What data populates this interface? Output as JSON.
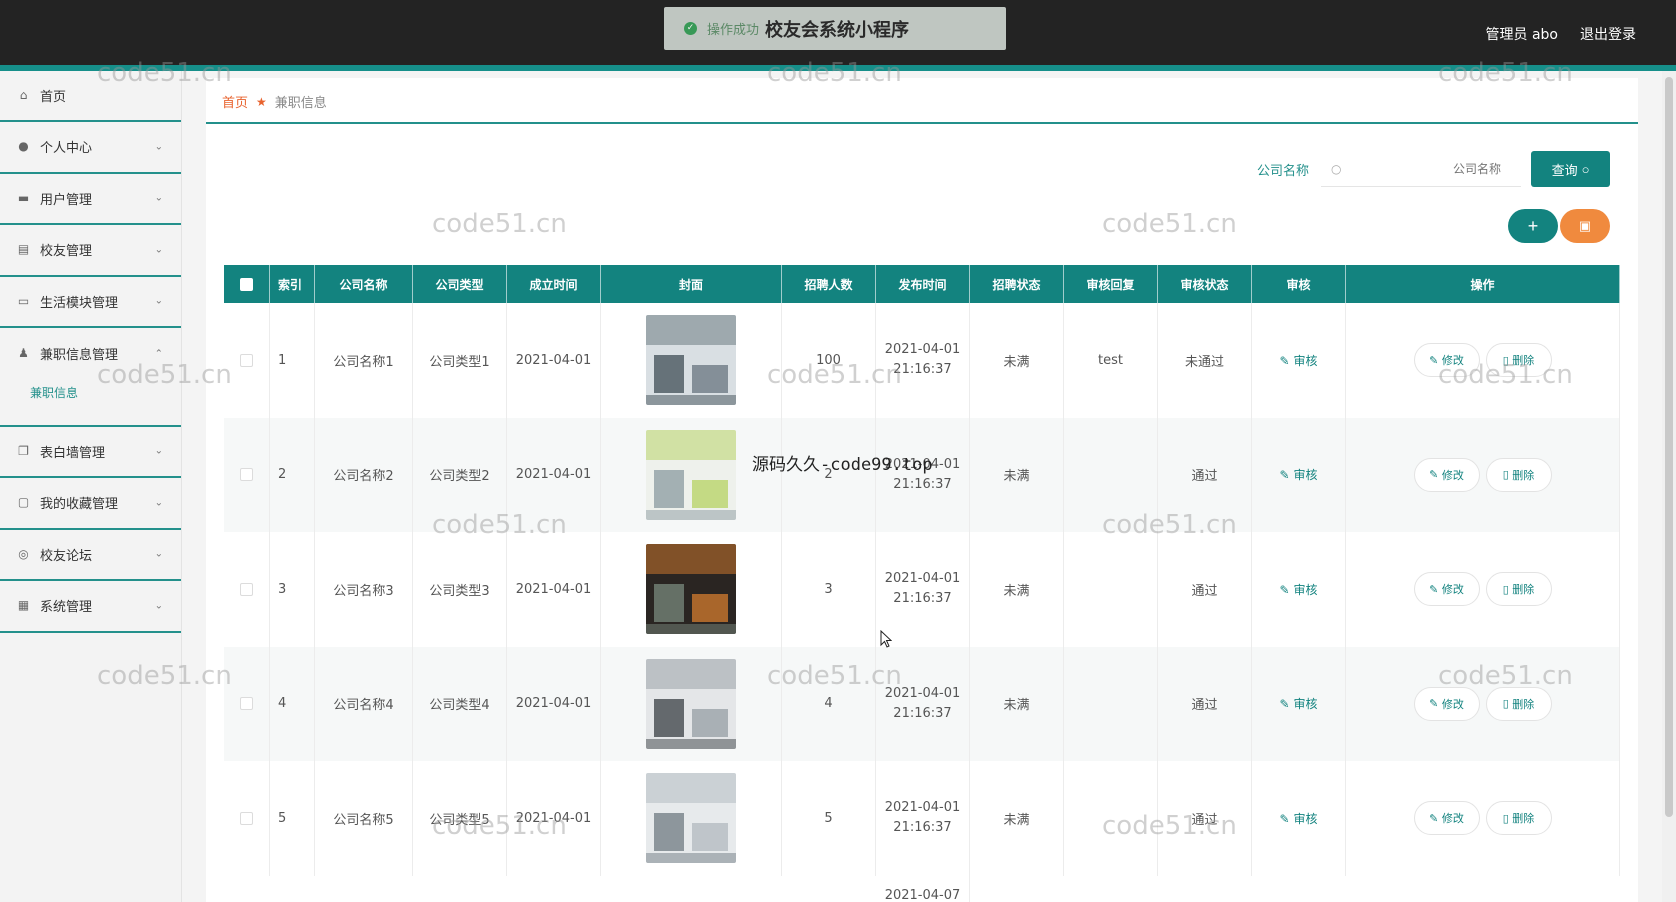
{
  "header": {
    "toast_msg": "操作成功",
    "app_title": "校友会系统小程序",
    "user_label": "管理员 abo",
    "logout_label": "退出登录"
  },
  "sidebar": {
    "home": "首页",
    "items": [
      {
        "label": "个人中心",
        "icon": "user-icon"
      },
      {
        "label": "用户管理",
        "icon": "users-icon"
      },
      {
        "label": "校友管理",
        "icon": "clipboard-icon"
      },
      {
        "label": "生活模块管理",
        "icon": "card-icon"
      },
      {
        "label": "兼职信息管理",
        "icon": "person-icon"
      },
      {
        "label": "表白墙管理",
        "icon": "copy-icon"
      },
      {
        "label": "我的收藏管理",
        "icon": "message-icon"
      },
      {
        "label": "校友论坛",
        "icon": "globe-icon"
      },
      {
        "label": "系统管理",
        "icon": "system-icon"
      }
    ],
    "sub_item": "兼职信息"
  },
  "breadcrumb": {
    "home": "首页",
    "current": "兼职信息"
  },
  "search": {
    "label": "公司名称",
    "placeholder": "公司名称",
    "button": "查询"
  },
  "table": {
    "columns": [
      "索引",
      "公司名称",
      "公司类型",
      "成立时间",
      "封面",
      "招聘人数",
      "发布时间",
      "招聘状态",
      "审核回复",
      "审核状态",
      "审核",
      "操作"
    ],
    "rows": [
      {
        "idx": "1",
        "name": "公司名称1",
        "type": "公司类型1",
        "date": "2021-04-01",
        "num": "100",
        "pub_date": "2021-04-01",
        "pub_time": "21:16:37",
        "status": "未满",
        "reply": "test",
        "audit": "未通过"
      },
      {
        "idx": "2",
        "name": "公司名称2",
        "type": "公司类型2",
        "date": "2021-04-01",
        "num": "2",
        "pub_date": "2021-04-01",
        "pub_time": "21:16:37",
        "status": "未满",
        "reply": "",
        "audit": "通过"
      },
      {
        "idx": "3",
        "name": "公司名称3",
        "type": "公司类型3",
        "date": "2021-04-01",
        "num": "3",
        "pub_date": "2021-04-01",
        "pub_time": "21:16:37",
        "status": "未满",
        "reply": "",
        "audit": "通过"
      },
      {
        "idx": "4",
        "name": "公司名称4",
        "type": "公司类型4",
        "date": "2021-04-01",
        "num": "4",
        "pub_date": "2021-04-01",
        "pub_time": "21:16:37",
        "status": "未满",
        "reply": "",
        "audit": "通过"
      },
      {
        "idx": "5",
        "name": "公司名称5",
        "type": "公司类型5",
        "date": "2021-04-01",
        "num": "5",
        "pub_date": "2021-04-01",
        "pub_time": "21:16:37",
        "status": "未满",
        "reply": "",
        "audit": "通过"
      }
    ],
    "partial_row_pub": "2021-04-07",
    "audit_link": "审核",
    "edit_label": "修改",
    "delete_label": "删除"
  },
  "watermark": "code51.cn",
  "overlay": "源码久久-code99.top",
  "colors": {
    "accent": "#13837f",
    "orange": "#f08a3e",
    "header": "#232323"
  }
}
